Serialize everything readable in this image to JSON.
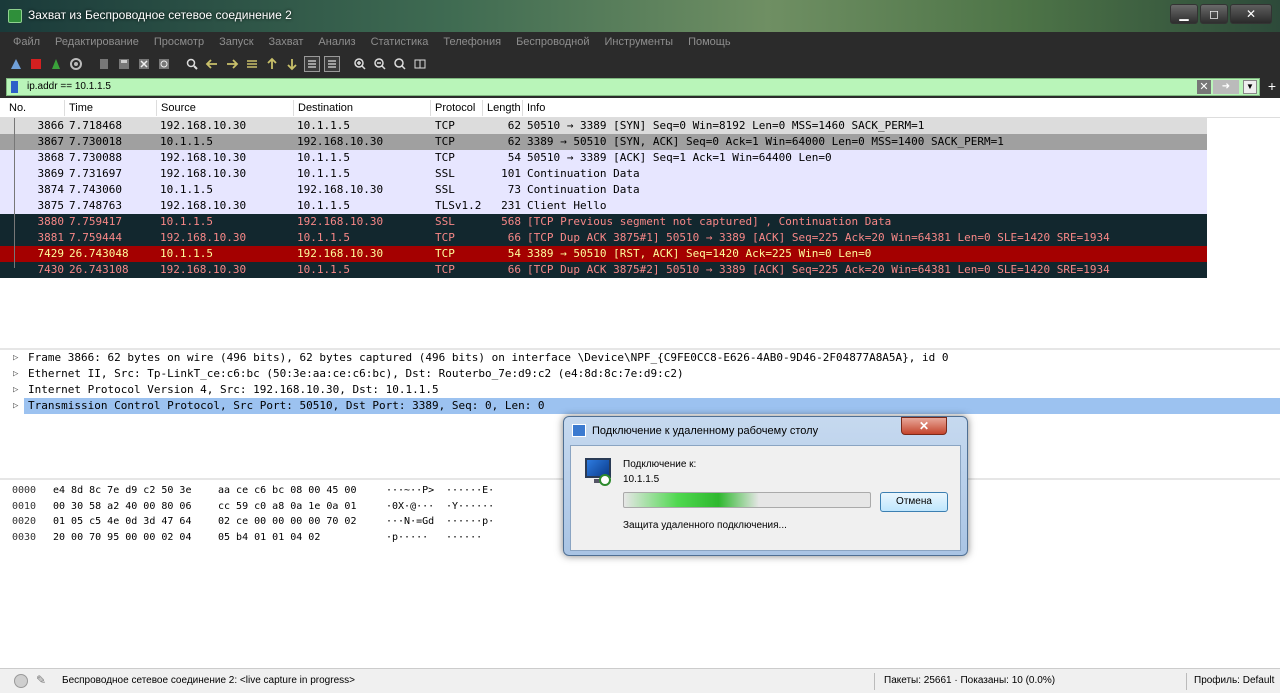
{
  "window": {
    "title": "Захват из Беспроводное сетевое соединение 2",
    "min_label": "▁",
    "max_label": "◻",
    "close_label": "✕"
  },
  "menu": [
    "Файл",
    "Редактирование",
    "Просмотр",
    "Запуск",
    "Захват",
    "Анализ",
    "Статистика",
    "Телефония",
    "Беспроводной",
    "Инструменты",
    "Помощь"
  ],
  "filter": {
    "value": "ip.addr == 10.1.1.5"
  },
  "columns": {
    "no": "No.",
    "time": "Time",
    "source": "Source",
    "destination": "Destination",
    "protocol": "Protocol",
    "length": "Length",
    "info": "Info"
  },
  "packets": [
    {
      "no": "3866",
      "time": "7.718468",
      "src": "192.168.10.30",
      "dst": "10.1.1.5",
      "proto": "TCP",
      "len": "62",
      "info": "50510 → 3389 [SYN] Seq=0 Win=8192 Len=0 MSS=1460 SACK_PERM=1",
      "bg": "#dcdcdc",
      "fg": "#000000"
    },
    {
      "no": "3867",
      "time": "7.730018",
      "src": "10.1.1.5",
      "dst": "192.168.10.30",
      "proto": "TCP",
      "len": "62",
      "info": "3389 → 50510 [SYN, ACK] Seq=0 Ack=1 Win=64000 Len=0 MSS=1400 SACK_PERM=1",
      "bg": "#a0a0a0",
      "fg": "#000000"
    },
    {
      "no": "3868",
      "time": "7.730088",
      "src": "192.168.10.30",
      "dst": "10.1.1.5",
      "proto": "TCP",
      "len": "54",
      "info": "50510 → 3389 [ACK] Seq=1 Ack=1 Win=64400 Len=0",
      "bg": "#e7e6ff",
      "fg": "#000000"
    },
    {
      "no": "3869",
      "time": "7.731697",
      "src": "192.168.10.30",
      "dst": "10.1.1.5",
      "proto": "SSL",
      "len": "101",
      "info": "Continuation Data",
      "bg": "#e7e6ff",
      "fg": "#000000"
    },
    {
      "no": "3874",
      "time": "7.743060",
      "src": "10.1.1.5",
      "dst": "192.168.10.30",
      "proto": "SSL",
      "len": "73",
      "info": "Continuation Data",
      "bg": "#e7e6ff",
      "fg": "#000000"
    },
    {
      "no": "3875",
      "time": "7.748763",
      "src": "192.168.10.30",
      "dst": "10.1.1.5",
      "proto": "TLSv1.2",
      "len": "231",
      "info": "Client Hello",
      "bg": "#e7e6ff",
      "fg": "#000000"
    },
    {
      "no": "3880",
      "time": "7.759417",
      "src": "10.1.1.5",
      "dst": "192.168.10.30",
      "proto": "SSL",
      "len": "568",
      "info": "[TCP Previous segment not captured] , Continuation Data",
      "bg": "#12272e",
      "fg": "#f78787"
    },
    {
      "no": "3881",
      "time": "7.759444",
      "src": "192.168.10.30",
      "dst": "10.1.1.5",
      "proto": "TCP",
      "len": "66",
      "info": "[TCP Dup ACK 3875#1] 50510 → 3389 [ACK] Seq=225 Ack=20 Win=64381 Len=0 SLE=1420 SRE=1934",
      "bg": "#12272e",
      "fg": "#f78787"
    },
    {
      "no": "7429",
      "time": "26.743048",
      "src": "10.1.1.5",
      "dst": "192.168.10.30",
      "proto": "TCP",
      "len": "54",
      "info": "3389 → 50510 [RST, ACK] Seq=1420 Ack=225 Win=0 Len=0",
      "bg": "#a40000",
      "fg": "#fffc9c"
    },
    {
      "no": "7430",
      "time": "26.743108",
      "src": "192.168.10.30",
      "dst": "10.1.1.5",
      "proto": "TCP",
      "len": "66",
      "info": "[TCP Dup ACK 3875#2] 50510 → 3389 [ACK] Seq=225 Ack=20 Win=64381 Len=0 SLE=1420 SRE=1934",
      "bg": "#12272e",
      "fg": "#f78787"
    }
  ],
  "details": [
    "Frame 3866: 62 bytes on wire (496 bits), 62 bytes captured (496 bits) on interface \\Device\\NPF_{C9FE0CC8-E626-4AB0-9D46-2F04877A8A5A}, id 0",
    "Ethernet II, Src: Tp-LinkT_ce:c6:bc (50:3e:aa:ce:c6:bc), Dst: Routerbo_7e:d9:c2 (e4:8d:8c:7e:d9:c2)",
    "Internet Protocol Version 4, Src: 192.168.10.30, Dst: 10.1.1.5",
    "Transmission Control Protocol, Src Port: 50510, Dst Port: 3389, Seq: 0, Len: 0"
  ],
  "hex": [
    {
      "off": "0000",
      "b1": "e4 8d 8c 7e d9 c2 50 3e",
      "b2": "aa ce c6 bc 08 00 45 00",
      "a1": "···~··P>",
      "a2": "······E·"
    },
    {
      "off": "0010",
      "b1": "00 30 58 a2 40 00 80 06",
      "b2": "cc 59 c0 a8 0a 1e 0a 01",
      "a1": "·0X·@···",
      "a2": "·Y······"
    },
    {
      "off": "0020",
      "b1": "01 05 c5 4e 0d 3d 47 64",
      "b2": "02 ce 00 00 00 00 70 02",
      "a1": "···N·=Gd",
      "a2": "······p·"
    },
    {
      "off": "0030",
      "b1": "20 00 70 95 00 00 02 04",
      "b2": "05 b4 01 01 04 02",
      "a1": " ·p·····",
      "a2": "······"
    }
  ],
  "status": {
    "text": "Беспроводное сетевое соединение 2: <live capture in progress>",
    "packets": "Пакеты: 25661 · Показаны: 10 (0.0%)",
    "profile": "Профиль: Default"
  },
  "dialog": {
    "title": "Подключение к удаленному рабочему столу",
    "close_label": "✕",
    "label": "Подключение к:",
    "host": "10.1.1.5",
    "status": "Защита удаленного подключения...",
    "cancel": "Отмена",
    "progress": 0.55
  }
}
